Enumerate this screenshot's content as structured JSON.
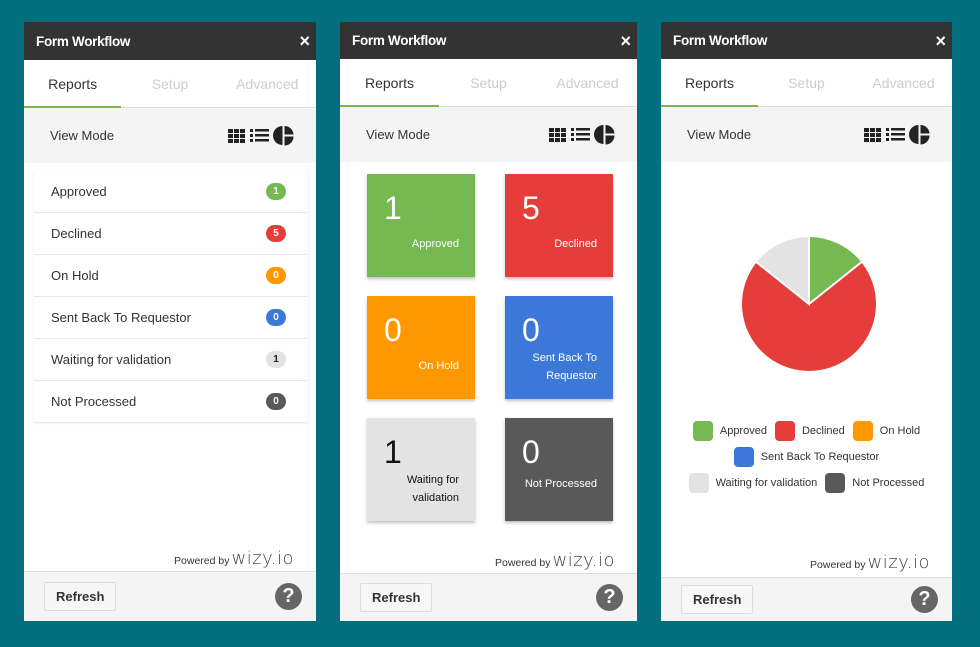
{
  "app": {
    "title": "Form Workflow",
    "close_icon": "×",
    "tabs": [
      {
        "label": "Reports",
        "active": true
      },
      {
        "label": "Setup",
        "active": false
      },
      {
        "label": "Advanced",
        "active": false
      }
    ],
    "view_mode_label": "View Mode",
    "view_mode_icons": [
      "grid-icon",
      "list-icon",
      "pie-chart-icon"
    ],
    "powered_by": "Powered by",
    "brand": "wizy.io",
    "refresh_label": "Refresh",
    "help_icon": "?"
  },
  "statuses": [
    {
      "label": "Approved",
      "count": "1",
      "color": "#76b852",
      "text_color": "#ffffff"
    },
    {
      "label": "Declined",
      "count": "5",
      "color": "#e53e3a",
      "text_color": "#ffffff"
    },
    {
      "label": "On Hold",
      "count": "0",
      "color": "#ff9800",
      "text_color": "#ffffff"
    },
    {
      "label": "Sent Back To Requestor",
      "count": "0",
      "color": "#3b78d8",
      "text_color": "#ffffff"
    },
    {
      "label": "Waiting for validation",
      "count": "1",
      "color": "#e3e3e3",
      "text_color": "#222222"
    },
    {
      "label": "Not Processed",
      "count": "0",
      "color": "#595959",
      "text_color": "#ffffff"
    }
  ],
  "panels": {
    "list_view": {
      "view": "list"
    },
    "tile_view": {
      "view": "tiles"
    },
    "chart_view": {
      "view": "pie"
    }
  },
  "chart_data": {
    "type": "pie",
    "title": "",
    "categories": [
      "Approved",
      "Declined",
      "On Hold",
      "Sent Back To Requestor",
      "Waiting for validation",
      "Not Processed"
    ],
    "values": [
      1,
      5,
      0,
      0,
      1,
      0
    ],
    "colors": [
      "#76b852",
      "#e53e3a",
      "#ff9800",
      "#3b78d8",
      "#e3e3e3",
      "#595959"
    ],
    "legend_position": "bottom"
  }
}
